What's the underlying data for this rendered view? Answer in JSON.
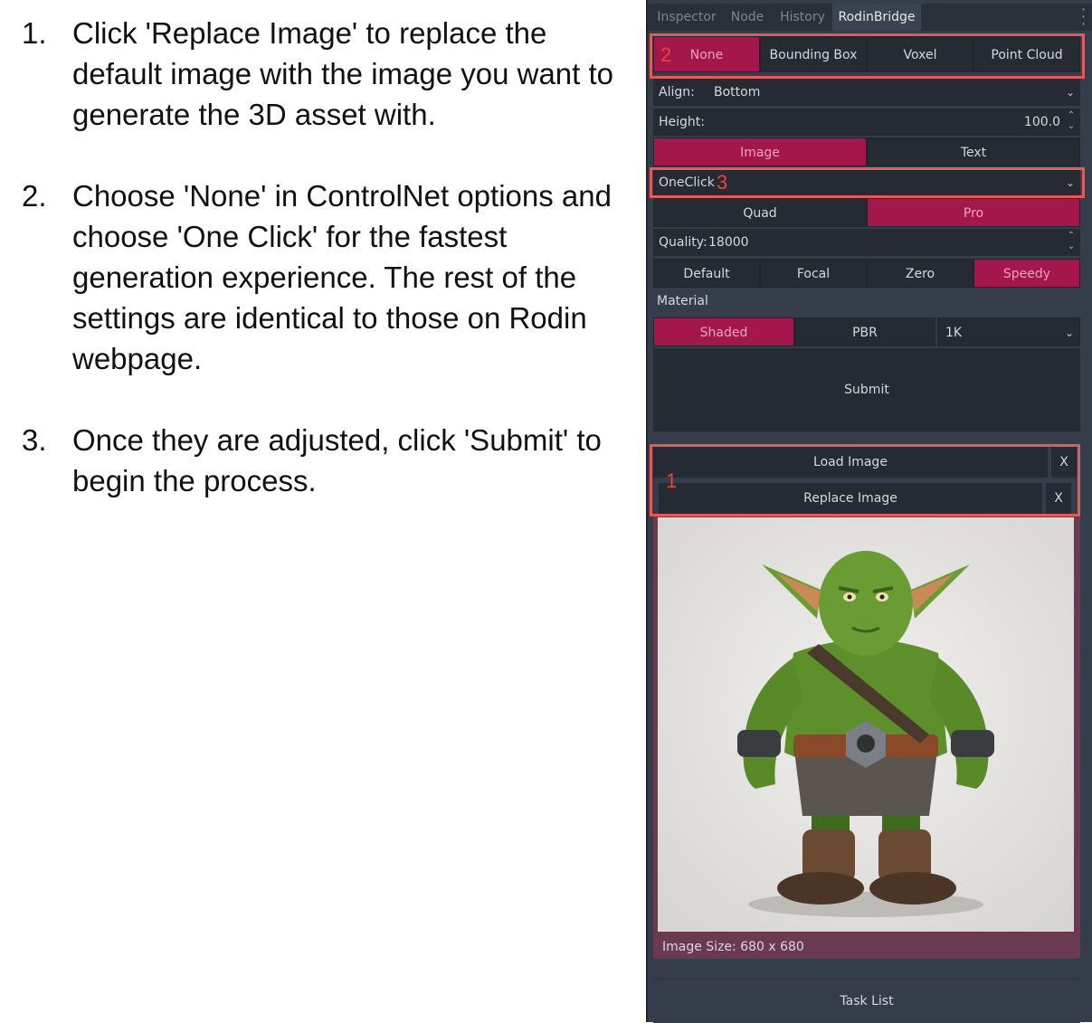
{
  "instructions": [
    {
      "num": "1.",
      "text": "Click 'Replace Image' to replace the default image with the image you want to generate the 3D asset with."
    },
    {
      "num": "2.",
      "text": "Choose 'None' in ControlNet options and choose 'One Click' for the fastest generation experience. The rest of the settings are identical to those on Rodin webpage."
    },
    {
      "num": "3.",
      "text": "Once they are adjusted, click 'Submit' to begin the process."
    }
  ],
  "tabs": [
    "Inspector",
    "Node",
    "History",
    "RodinBridge"
  ],
  "active_tab": "RodinBridge",
  "controlnet": [
    "None",
    "Bounding Box",
    "Voxel",
    "Point Cloud"
  ],
  "align": {
    "label": "Align:",
    "value": "Bottom"
  },
  "height": {
    "label": "Height:",
    "value": "100.0"
  },
  "mode": [
    "Image",
    "Text"
  ],
  "generation": {
    "value": "OneClick"
  },
  "mesh": [
    "Quad",
    "Pro"
  ],
  "quality": {
    "label": "Quality:",
    "value": "18000"
  },
  "speed": [
    "Default",
    "Focal",
    "Zero",
    "Speedy"
  ],
  "material": {
    "label": "Material",
    "options": [
      "Shaded",
      "PBR"
    ],
    "resolution": "1K"
  },
  "submit": "Submit",
  "load_image": "Load Image",
  "replace_image": "Replace Image",
  "close": "X",
  "image_size": "Image Size: 680 x 680",
  "task_list": "Task List",
  "markers": [
    "1",
    "2",
    "3"
  ],
  "colors": {
    "accent": "#a3174a",
    "annotation": "#e15b5b",
    "panel": "#363d4a"
  }
}
